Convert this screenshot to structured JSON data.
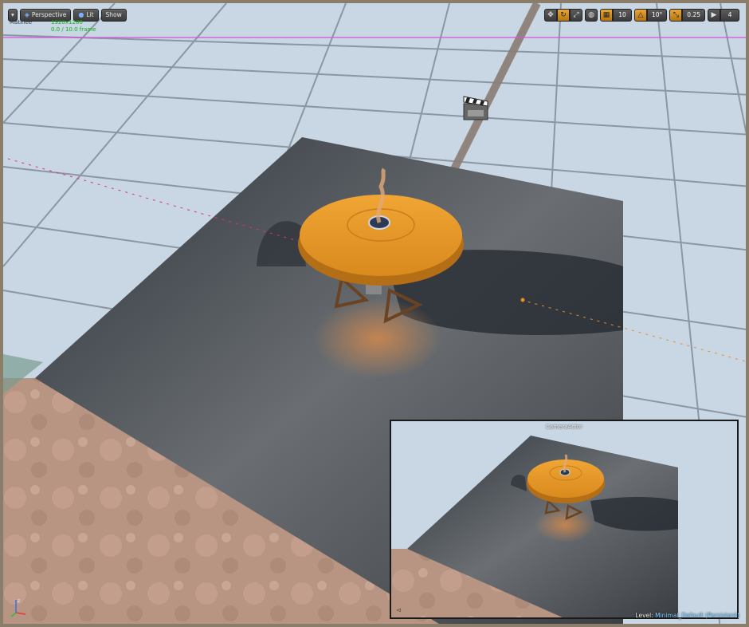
{
  "toolbar_left": {
    "menu_icon": "chevron-down-icon",
    "perspective": "Perspective",
    "lit": "Lit",
    "show": "Show"
  },
  "stats": {
    "mode": "Matinee",
    "resolution": "1920x1280",
    "frame": "0.0 / 10.0 frame"
  },
  "toolbar_right": {
    "icons": [
      "move-icon",
      "rotate-icon",
      "scale-icon",
      "world-icon",
      "grid-snap-icon",
      "rotation-snap-icon",
      "scale-snap-icon",
      "camera-speed-icon"
    ],
    "grid_snap": "10",
    "rotation_snap": "10°",
    "scale_snap": "0.25",
    "camera_speed": "4"
  },
  "preview": {
    "title": "CameraActor"
  },
  "level": {
    "label": "Level:",
    "name": "Minimal_Default (Persistent)"
  },
  "axis": {
    "z": "z",
    "x": "x",
    "y": "y"
  },
  "colors": {
    "accent": "#e7a637",
    "table": "#e89a2c",
    "floor": "#55585c",
    "sky": "#c9d7e4"
  }
}
